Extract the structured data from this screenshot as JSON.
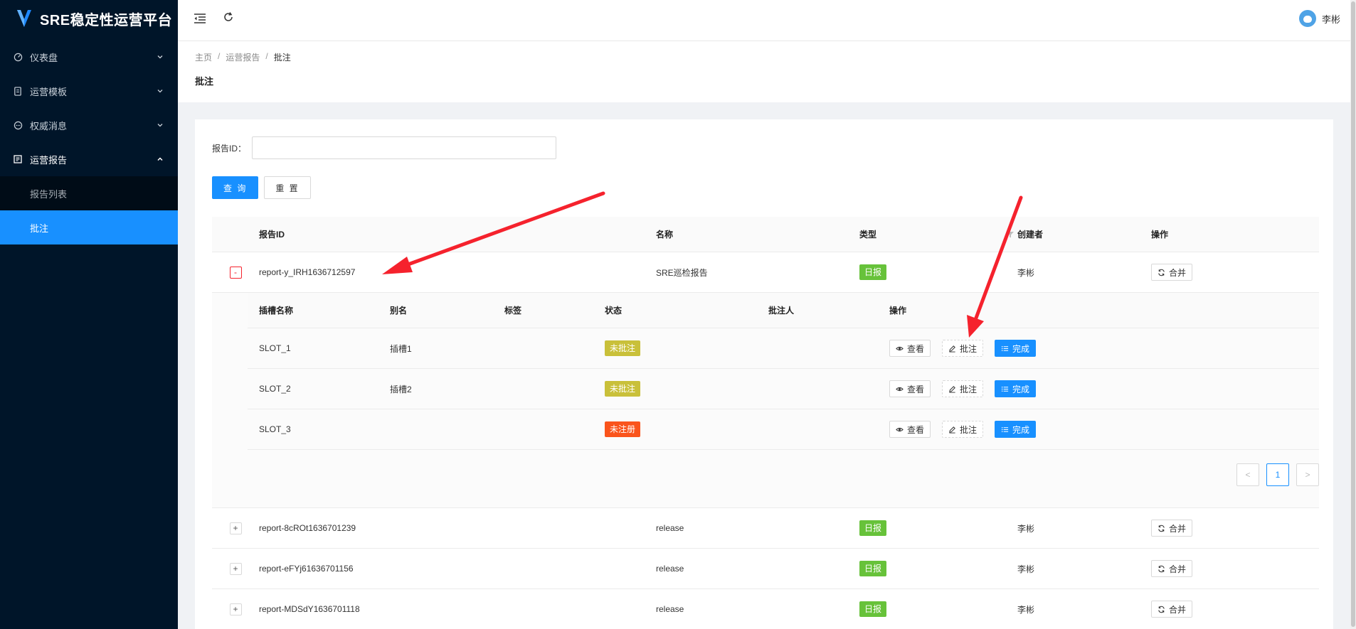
{
  "app": {
    "title": "SRE稳定性运营平台"
  },
  "sidebar": {
    "items": [
      {
        "label": "仪表盘",
        "icon": "dashboard-icon"
      },
      {
        "label": "运营模板",
        "icon": "file-icon"
      },
      {
        "label": "权威消息",
        "icon": "message-icon"
      },
      {
        "label": "运营报告",
        "icon": "report-icon"
      }
    ],
    "sub_items": [
      {
        "label": "报告列表"
      },
      {
        "label": "批注"
      }
    ]
  },
  "header": {
    "user_name": "李彬"
  },
  "breadcrumb": {
    "home": "主页",
    "section": "运营报告",
    "current": "批注"
  },
  "page_title": "批注",
  "search": {
    "label": "报告ID：",
    "value": "",
    "query_label": "查 询",
    "reset_label": "重 置"
  },
  "table": {
    "columns": {
      "id": "报告ID",
      "name": "名称",
      "type": "类型",
      "creator": "创建者",
      "op": "操作"
    },
    "expanded_row": {
      "id": "report-y_IRH1636712597",
      "name": "SRE巡检报告",
      "type": "日报",
      "creator": "李彬",
      "op": "合并",
      "expand_symbol": "-"
    },
    "rows": [
      {
        "id": "report-8cROt1636701239",
        "name": "release",
        "type": "日报",
        "creator": "李彬",
        "op": "合并",
        "expand_symbol": "+"
      },
      {
        "id": "report-eFYj61636701156",
        "name": "release",
        "type": "日报",
        "creator": "李彬",
        "op": "合并",
        "expand_symbol": "+"
      },
      {
        "id": "report-MDSdY1636701118",
        "name": "release",
        "type": "日报",
        "creator": "李彬",
        "op": "合并",
        "expand_symbol": "+"
      }
    ]
  },
  "subtable": {
    "columns": {
      "slot": "插槽名称",
      "alias": "别名",
      "tag": "标签",
      "status": "状态",
      "annotator": "批注人",
      "op": "操作"
    },
    "rows": [
      {
        "slot": "SLOT_1",
        "alias": "插槽1",
        "tag": "",
        "status": "未批注",
        "status_color": "#c9c03a",
        "annotator": ""
      },
      {
        "slot": "SLOT_2",
        "alias": "插槽2",
        "tag": "",
        "status": "未批注",
        "status_color": "#c9c03a",
        "annotator": ""
      },
      {
        "slot": "SLOT_3",
        "alias": "",
        "tag": "",
        "status": "未注册",
        "status_color": "#fa541c",
        "annotator": ""
      }
    ],
    "actions": {
      "view": "查看",
      "annotate": "批注",
      "done": "完成"
    },
    "pagination": {
      "prev": "<",
      "page": "1",
      "next": ">"
    }
  },
  "colors": {
    "sidebar_bg": "#001529",
    "primary": "#1890ff",
    "tag_green": "#67c23a",
    "arrow": "#f5222d"
  }
}
